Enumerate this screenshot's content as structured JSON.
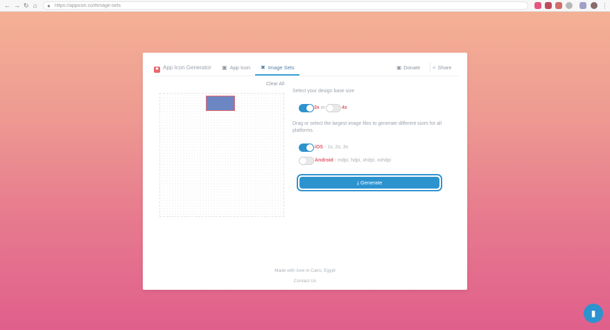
{
  "browser": {
    "url": "https://appicon.co/#image-sets",
    "back": "←",
    "forward": "→",
    "reload": "↻",
    "home": "⌂",
    "lock": "🔒"
  },
  "header": {
    "brand": "App Icon Generator",
    "tabs": [
      {
        "icon": "▣",
        "label": "App Icon"
      },
      {
        "icon": "✖",
        "label": "Image Sets"
      }
    ],
    "donate": "Donate",
    "share": "Share"
  },
  "left": {
    "clear_all": "Clear All"
  },
  "right": {
    "base_size_label": "Select your design base size",
    "opt_3x": "3x",
    "or": "or",
    "opt_4x": "4x",
    "drag_text": "Drag or select the largest image files to generate different sizes for all platforms.",
    "ios_label": "iOS",
    "ios_sub": " - 1x, 2x, 3x",
    "android_label": "Android",
    "android_sub": " - mdpi, hdpi, xhdpi, xxhdpi",
    "generate": "⤓  Generate"
  },
  "footer": {
    "made_with": "Made with love in Cairo, Egypt",
    "contact": "Contact Us"
  },
  "colors": {
    "accent": "#2d93cf",
    "brand": "#e8686c"
  },
  "toggles": {
    "3x": true,
    "4x": false,
    "ios": true,
    "android": false
  }
}
